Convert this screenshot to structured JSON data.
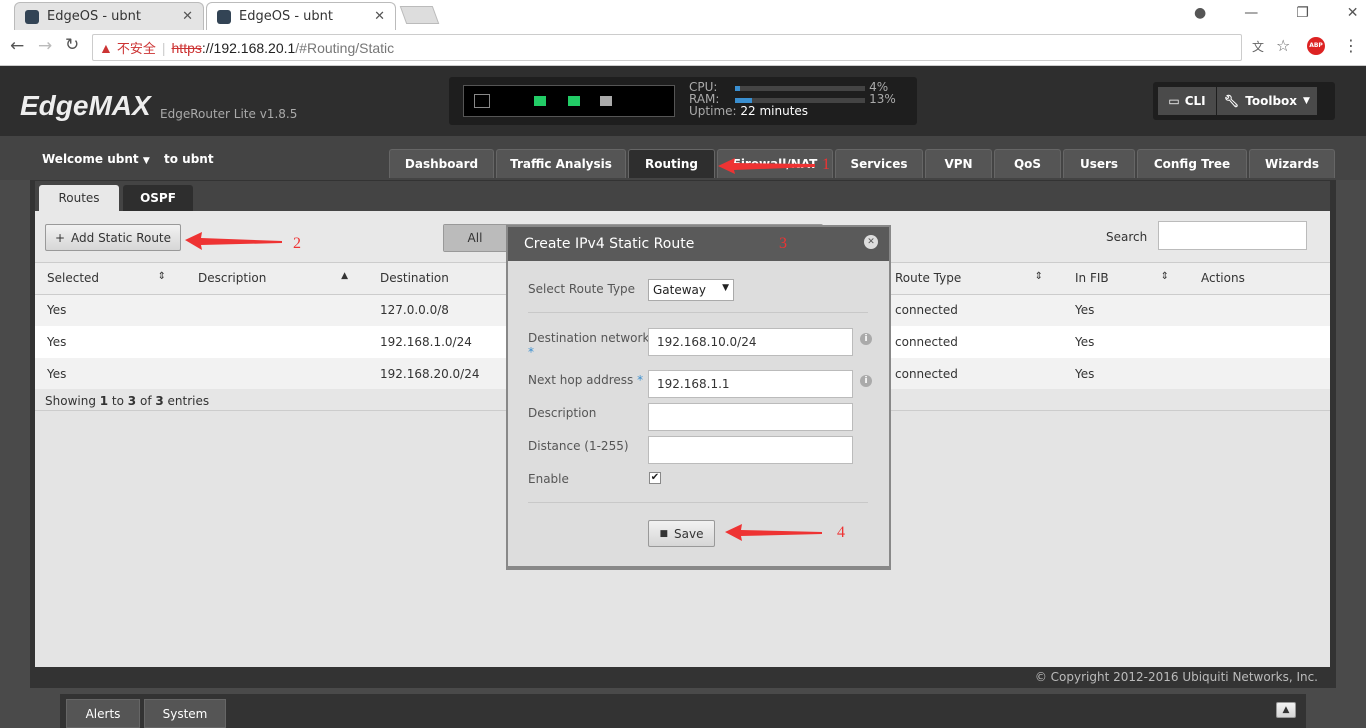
{
  "browser": {
    "tabs": [
      {
        "title": "EdgeOS - ubnt"
      },
      {
        "title": "EdgeOS - ubnt"
      }
    ],
    "security": "不安全",
    "url_scheme": "https",
    "url_host": "://192.168.20.1",
    "url_path": "/#Routing/Static"
  },
  "header": {
    "logo": "EdgeMAX",
    "model": "EdgeRouter Lite v1.8.5",
    "cpu_label": "CPU:",
    "cpu_value": "4%",
    "cpu_pct": 4,
    "ram_label": "RAM:",
    "ram_value": "13%",
    "ram_pct": 13,
    "uptime_label": "Uptime:",
    "uptime_value": "22 minutes",
    "cli": "CLI",
    "toolbox": "Toolbox"
  },
  "nav": {
    "welcome": "Welcome ubnt",
    "to": "to ubnt",
    "tabs": [
      "Dashboard",
      "Traffic Analysis",
      "Routing",
      "Firewall/NAT",
      "Services",
      "VPN",
      "QoS",
      "Users",
      "Config Tree",
      "Wizards"
    ],
    "active": "Routing"
  },
  "subtabs": [
    "Routes",
    "OSPF"
  ],
  "toolbar": {
    "add": "Add Static Route",
    "filter_all": "All",
    "search_label": "Search",
    "search_value": ""
  },
  "table": {
    "headers": [
      "Selected",
      "Description",
      "Destination",
      "Route Type",
      "In FIB",
      "Actions"
    ],
    "rows": [
      [
        "Yes",
        "",
        "127.0.0.0/8",
        "connected",
        "Yes"
      ],
      [
        "Yes",
        "",
        "192.168.1.0/24",
        "connected",
        "Yes"
      ],
      [
        "Yes",
        "",
        "192.168.20.0/24",
        "connected",
        "Yes"
      ]
    ],
    "showing_pre": "Showing ",
    "from": "1",
    "to_word": " to ",
    "to": "3",
    "of_word": " of ",
    "total": "3",
    "entries": " entries"
  },
  "modal": {
    "title": "Create IPv4 Static Route",
    "route_type_label": "Select Route Type",
    "route_type": "Gateway",
    "dest_label": "Destination network",
    "dest_value": "192.168.10.0/24",
    "nexthop_label": "Next hop address",
    "nexthop_value": "192.168.1.1",
    "desc_label": "Description",
    "desc_value": "",
    "distance_label": "Distance (1-255)",
    "distance_value": "",
    "enable_label": "Enable",
    "enable_checked": true,
    "save": "Save"
  },
  "annotations": [
    "1",
    "2",
    "3",
    "4"
  ],
  "footer": {
    "copyright": "© Copyright 2012-2016 Ubiquiti Networks, Inc.",
    "alerts": "Alerts",
    "system": "System"
  }
}
